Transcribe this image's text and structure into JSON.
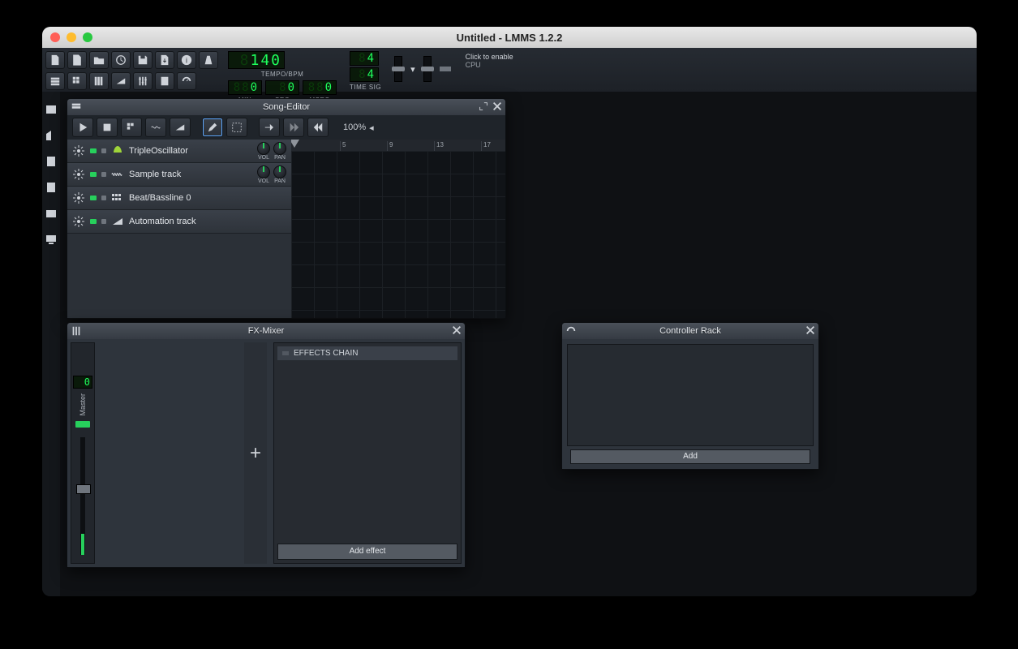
{
  "window": {
    "title": "Untitled - LMMS 1.2.2"
  },
  "transport": {
    "tempo": "140",
    "tempo_label": "TEMPO/BPM",
    "min": "0",
    "sec": "0",
    "msec": "0",
    "min_label": "MIN",
    "sec_label": "SEC",
    "msec_label": "MSEC",
    "timesig_num": "4",
    "timesig_den": "4",
    "timesig_label": "TIME SIG",
    "cpu_hint": "Click to enable",
    "cpu_label": "CPU"
  },
  "song_editor": {
    "title": "Song-Editor",
    "zoom": "100%",
    "ruler": [
      "5",
      "9",
      "13",
      "17"
    ],
    "tracks": [
      {
        "name": "TripleOscillator",
        "icon": "triosc",
        "knobs": true,
        "vol": "VOL",
        "pan": "PAN"
      },
      {
        "name": "Sample track",
        "icon": "wave",
        "knobs": true,
        "vol": "VOL",
        "pan": "PAN"
      },
      {
        "name": "Beat/Bassline 0",
        "icon": "grid",
        "knobs": false
      },
      {
        "name": "Automation track",
        "icon": "ramp",
        "knobs": false
      }
    ]
  },
  "fx_mixer": {
    "title": "FX-Mixer",
    "master_label": "Master",
    "master_send": "0",
    "chain_label": "EFFECTS CHAIN",
    "add_effect": "Add effect"
  },
  "controller_rack": {
    "title": "Controller Rack",
    "add": "Add"
  }
}
